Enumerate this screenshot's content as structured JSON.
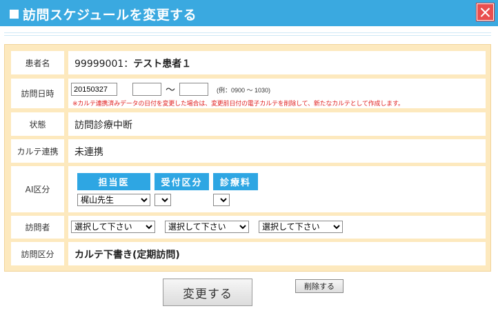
{
  "window": {
    "title": "訪問スケジュールを変更する",
    "close_label": "×"
  },
  "patient": {
    "label": "患者名",
    "id": "99999001：",
    "name": "テスト患者１"
  },
  "visit_date": {
    "label": "訪問日時",
    "date_value": "20150327",
    "start_time_value": "",
    "end_time_value": "",
    "separator": "～",
    "example": "(例：0900 ～ 1030)",
    "warning": "※カルテ連携済みデータの日付を変更した場合は、変更前日付の電子カルテを削除して、新たなカルテとして作成します。"
  },
  "status": {
    "label": "状態",
    "value": "訪問診療中断"
  },
  "karte_link": {
    "label": "カルテ連携",
    "value": "未連携"
  },
  "ai_category": {
    "label": "AI区分",
    "headers": [
      "担当医",
      "受付区分",
      "診療料"
    ],
    "doctor_selected": "梶山先生",
    "reception_selected": "",
    "fee_selected": ""
  },
  "visitor": {
    "label": "訪問者",
    "select1": "選択して下さい",
    "select2": "選択して下さい",
    "select3": "選択して下さい"
  },
  "visit_type": {
    "label": "訪問区分",
    "value": "カルテ下書き(定期訪問)"
  },
  "buttons": {
    "change": "変更する",
    "delete": "削除する"
  },
  "colors": {
    "titlebar": "#3aa9e0",
    "frame": "#fde9be",
    "ai_header": "#2ea6e3",
    "warning": "#e02020",
    "close": "#e94f4f"
  }
}
